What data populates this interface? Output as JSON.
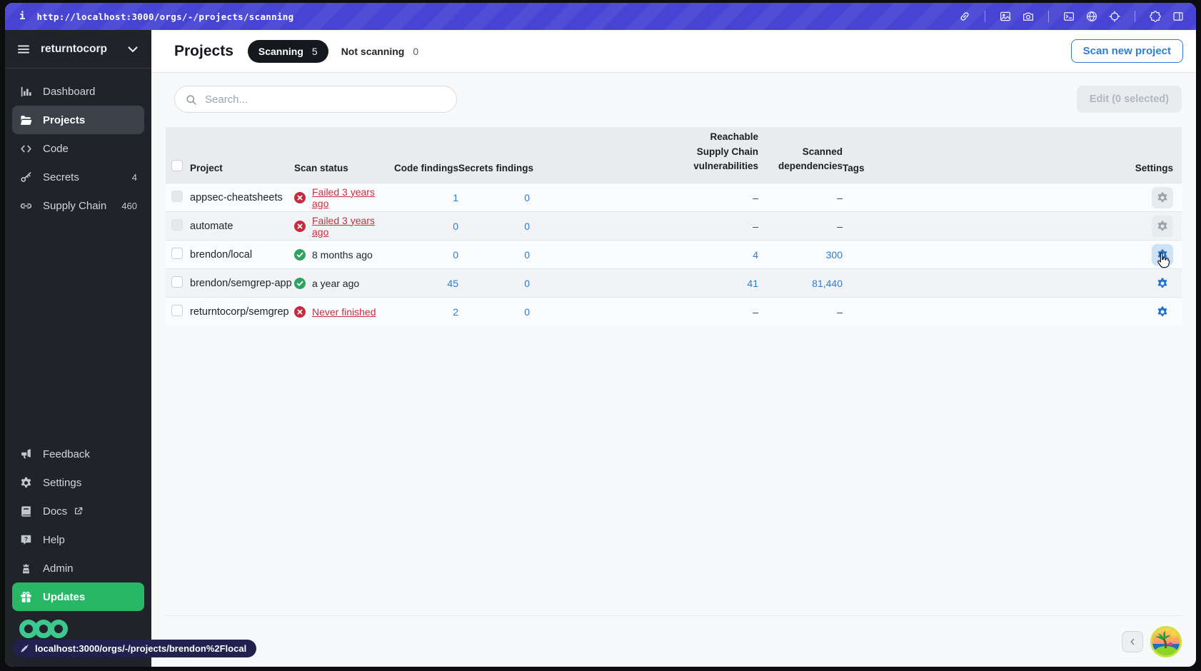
{
  "window": {
    "info_glyph": "i",
    "url": "http://localhost:3000/orgs/-/projects/scanning"
  },
  "topbar_icon_groups": [
    [
      "link-icon"
    ],
    [
      "image-icon",
      "camera-icon"
    ],
    [
      "terminal-icon",
      "globe-icon",
      "target-icon"
    ],
    [
      "extensions-icon",
      "split-view-icon"
    ]
  ],
  "sidebar": {
    "org_name": "returntocorp",
    "items": [
      {
        "label": "Dashboard",
        "icon": "dashboard-icon",
        "badge": "",
        "active": false
      },
      {
        "label": "Projects",
        "icon": "folder-icon",
        "badge": "",
        "active": true
      },
      {
        "label": "Code",
        "icon": "code-icon",
        "badge": "",
        "active": false
      },
      {
        "label": "Secrets",
        "icon": "key-icon",
        "badge": "4",
        "active": false
      },
      {
        "label": "Supply Chain",
        "icon": "chain-icon",
        "badge": "460",
        "active": false
      }
    ],
    "footer_items": [
      {
        "label": "Feedback",
        "icon": "megaphone-icon",
        "external": false,
        "highlight": false
      },
      {
        "label": "Settings",
        "icon": "gear-icon",
        "external": false,
        "highlight": false
      },
      {
        "label": "Docs",
        "icon": "book-icon",
        "external": true,
        "highlight": false
      },
      {
        "label": "Help",
        "icon": "help-icon",
        "external": false,
        "highlight": false
      },
      {
        "label": "Admin",
        "icon": "admin-icon",
        "external": false,
        "highlight": false
      },
      {
        "label": "Updates",
        "icon": "gift-icon",
        "external": false,
        "highlight": true
      }
    ]
  },
  "header": {
    "title": "Projects",
    "tabs": [
      {
        "label": "Scanning",
        "count": "5",
        "active": true
      },
      {
        "label": "Not scanning",
        "count": "0",
        "active": false
      }
    ],
    "scan_new_button": "Scan new project"
  },
  "controls": {
    "search_placeholder": "Search...",
    "edit_button": "Edit (0 selected)"
  },
  "table": {
    "headers": {
      "project": "Project",
      "scan_status": "Scan status",
      "code_findings": "Code findings",
      "secrets_findings": "Secrets findings",
      "vulns": "Reachable Supply Chain vulnerabilities",
      "deps": "Scanned dependencies",
      "tags": "Tags",
      "settings": "Settings"
    },
    "rows": [
      {
        "project": "appsec-cheatsheets",
        "status_text": "Failed 3 years ago",
        "status_type": "failed",
        "code_findings": "1",
        "secrets_findings": "0",
        "vulns": "–",
        "deps": "–",
        "tags": "",
        "gear_style": "muted",
        "muted": true
      },
      {
        "project": "automate",
        "status_text": "Failed 3 years ago",
        "status_type": "failed",
        "code_findings": "0",
        "secrets_findings": "0",
        "vulns": "–",
        "deps": "–",
        "tags": "",
        "gear_style": "muted",
        "muted": true
      },
      {
        "project": "brendon/local",
        "status_text": "8 months ago",
        "status_type": "success",
        "code_findings": "0",
        "secrets_findings": "0",
        "vulns": "4",
        "deps": "300",
        "tags": "",
        "gear_style": "active-hover",
        "muted": false
      },
      {
        "project": "brendon/semgrep-app",
        "status_text": "a year ago",
        "status_type": "success",
        "code_findings": "45",
        "secrets_findings": "0",
        "vulns": "41",
        "deps": "81,440",
        "tags": "",
        "gear_style": "active",
        "muted": false
      },
      {
        "project": "returntocorp/semgrep",
        "status_text": "Never finished",
        "status_type": "failed",
        "code_findings": "2",
        "secrets_findings": "0",
        "vulns": "–",
        "deps": "–",
        "tags": "",
        "gear_style": "active",
        "muted": false
      }
    ]
  },
  "status_popup": {
    "icon": "slashed-pencil-icon",
    "text": "localhost:3000/orgs/-/projects/brendon%2Flocal"
  },
  "colors": {
    "accent_blue": "#2b7cd9",
    "danger_red": "#c5313d",
    "success_green": "#2fa360",
    "updates_green": "#28b865",
    "topbar_indigo": "#4744d4",
    "logo_green": "#3bc98f"
  }
}
